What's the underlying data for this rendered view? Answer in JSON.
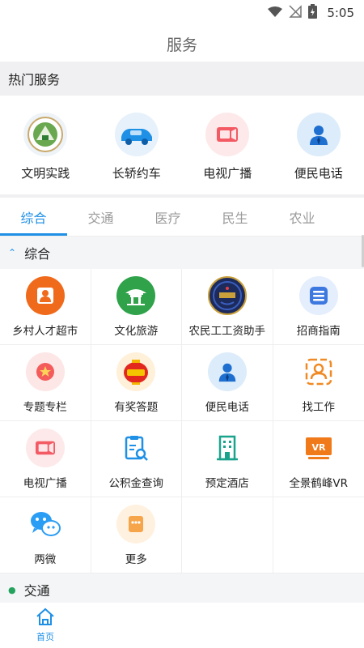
{
  "status": {
    "time": "5:05"
  },
  "header": {
    "title": "服务"
  },
  "hot": {
    "title": "热门服务",
    "items": [
      {
        "label": "文明实践",
        "icon": "civilization-emblem-icon"
      },
      {
        "label": "长轿约车",
        "icon": "car-icon"
      },
      {
        "label": "电视广播",
        "icon": "video-icon"
      },
      {
        "label": "便民电话",
        "icon": "person-icon"
      }
    ]
  },
  "tabs": [
    {
      "label": "综合",
      "active": true
    },
    {
      "label": "交通"
    },
    {
      "label": "医疗"
    },
    {
      "label": "民生"
    },
    {
      "label": "农业"
    }
  ],
  "general": {
    "title": "综合",
    "items": [
      {
        "label": "乡村人才超市",
        "icon": "talent-icon"
      },
      {
        "label": "文化旅游",
        "icon": "pavilion-icon"
      },
      {
        "label": "农民工工资助手",
        "icon": "wage-badge-icon"
      },
      {
        "label": "招商指南",
        "icon": "list-icon"
      },
      {
        "label": "专题专栏",
        "icon": "star-icon"
      },
      {
        "label": "有奖答题",
        "icon": "lantern-icon"
      },
      {
        "label": "便民电话",
        "icon": "person-icon"
      },
      {
        "label": "找工作",
        "icon": "job-search-icon"
      },
      {
        "label": "电视广播",
        "icon": "video-icon"
      },
      {
        "label": "公积金查询",
        "icon": "fund-search-icon"
      },
      {
        "label": "预定酒店",
        "icon": "hotel-icon"
      },
      {
        "label": "全景鹤峰VR",
        "icon": "vr-icon"
      },
      {
        "label": "两微",
        "icon": "weibo-wechat-icon"
      },
      {
        "label": "更多",
        "icon": "more-icon"
      }
    ]
  },
  "traffic": {
    "title": "交通"
  },
  "bottom_nav": {
    "home_label": "首页"
  },
  "colors": {
    "accent": "#1e90e6",
    "orange": "#f08a24",
    "green": "#23a35d"
  }
}
